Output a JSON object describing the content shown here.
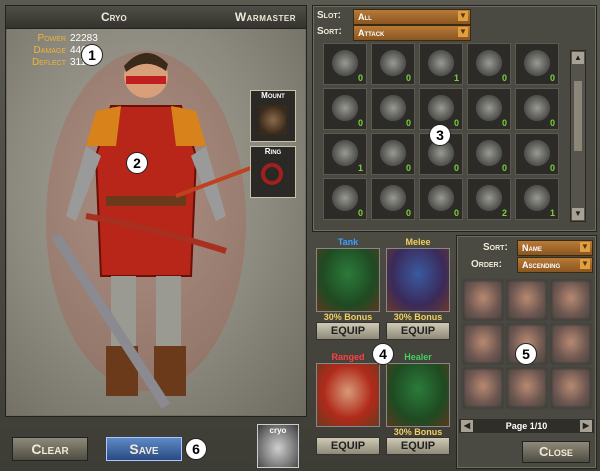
{
  "character": {
    "name": "Cryo",
    "class": "Warmaster"
  },
  "stats": [
    {
      "label": "Power",
      "value": "22283"
    },
    {
      "label": "Damage",
      "value": "440"
    },
    {
      "label": "Deflect",
      "value": "311"
    }
  ],
  "equipment_slots": {
    "mount": "Mount",
    "ring": "Ring"
  },
  "inventory": {
    "slot_label": "Slot:",
    "slot_value": "All",
    "sort_label": "Sort:",
    "sort_value": "Attack",
    "items": [
      {
        "qty": "0"
      },
      {
        "qty": "0"
      },
      {
        "qty": "1"
      },
      {
        "qty": "0"
      },
      {
        "qty": "0"
      },
      {
        "qty": "0"
      },
      {
        "qty": "0"
      },
      {
        "qty": "0"
      },
      {
        "qty": "0"
      },
      {
        "qty": "0"
      },
      {
        "qty": "1"
      },
      {
        "qty": "0"
      },
      {
        "qty": "0"
      },
      {
        "qty": "0"
      },
      {
        "qty": "0"
      },
      {
        "qty": "0"
      },
      {
        "qty": "0"
      },
      {
        "qty": "0"
      },
      {
        "qty": "2"
      },
      {
        "qty": "1"
      }
    ]
  },
  "companions": [
    {
      "role": "Tank",
      "role_color": "#3aa0ff",
      "bonus": "30% Bonus",
      "equip": "EQUIP"
    },
    {
      "role": "Melee",
      "role_color": "#f0d060",
      "bonus": "30% Bonus",
      "equip": "EQUIP"
    },
    {
      "role": "Ranged",
      "role_color": "#ff4040",
      "bonus": "",
      "equip": "EQUIP"
    },
    {
      "role": "Healer",
      "role_color": "#40d060",
      "bonus": "30% Bonus",
      "equip": "EQUIP"
    }
  ],
  "roster": {
    "sort_label": "Sort:",
    "sort_value": "Name",
    "order_label": "Order:",
    "order_value": "Ascending",
    "page": "Page 1/10"
  },
  "buttons": {
    "clear": "Clear",
    "save": "Save",
    "close": "Close"
  },
  "avatar": {
    "name": "cryo"
  },
  "badges": [
    "1",
    "2",
    "3",
    "4",
    "5",
    "6"
  ],
  "icons": {
    "arrow": "▼",
    "up": "▲",
    "down": "▼",
    "left": "◀",
    "right": "▶"
  }
}
